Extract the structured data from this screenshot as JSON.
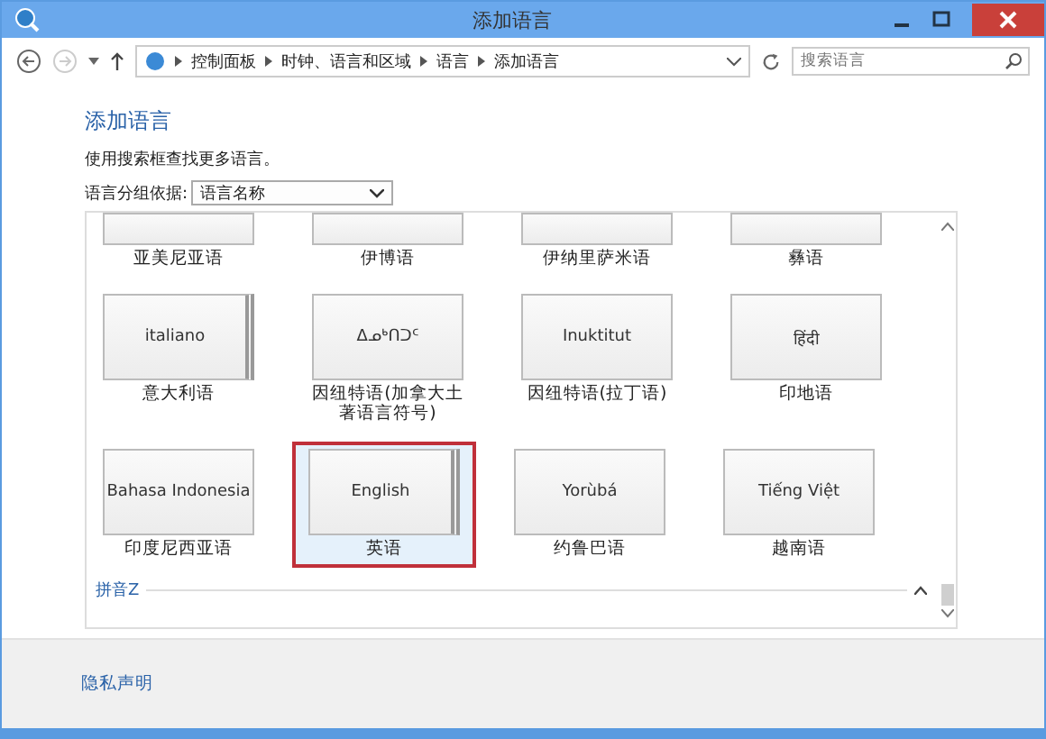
{
  "window": {
    "title": "添加语言"
  },
  "breadcrumb": [
    "控制面板",
    "时钟、语言和区域",
    "语言",
    "添加语言"
  ],
  "search": {
    "placeholder": "搜索语言"
  },
  "heading": "添加语言",
  "hint": "使用搜索框查找更多语言。",
  "group_by": {
    "label": "语言分组依据:",
    "value": "语言名称"
  },
  "rows": [
    [
      {
        "name": "亚美尼亚语",
        "stacked": false,
        "selected": false
      },
      {
        "name": "伊博语",
        "stacked": false,
        "selected": false
      },
      {
        "name": "伊纳里萨米语",
        "stacked": false,
        "selected": false
      },
      {
        "name": "彝语",
        "stacked": false,
        "selected": false
      }
    ],
    [
      {
        "native": "italiano",
        "name": "意大利语",
        "stacked": true,
        "selected": false
      },
      {
        "native": "ᐃᓄᒃᑎᑐᑦ",
        "name": "因纽特语(加拿大土著语言符号)",
        "stacked": false,
        "selected": false
      },
      {
        "native": "Inuktitut",
        "name": "因纽特语(拉丁语)",
        "stacked": false,
        "selected": false
      },
      {
        "native": "हिंदी",
        "name": "印地语",
        "stacked": false,
        "selected": false
      }
    ],
    [
      {
        "native": "Bahasa Indonesia",
        "name": "印度尼西亚语",
        "stacked": false,
        "selected": false
      },
      {
        "native": "English",
        "name": "英语",
        "stacked": true,
        "selected": true
      },
      {
        "native": "Yorùbá",
        "name": "约鲁巴语",
        "stacked": false,
        "selected": false
      },
      {
        "native": "Tiếng Việt",
        "name": "越南语",
        "stacked": false,
        "selected": false
      }
    ]
  ],
  "group_header": "拼音Z",
  "footer_link": "隐私声明"
}
